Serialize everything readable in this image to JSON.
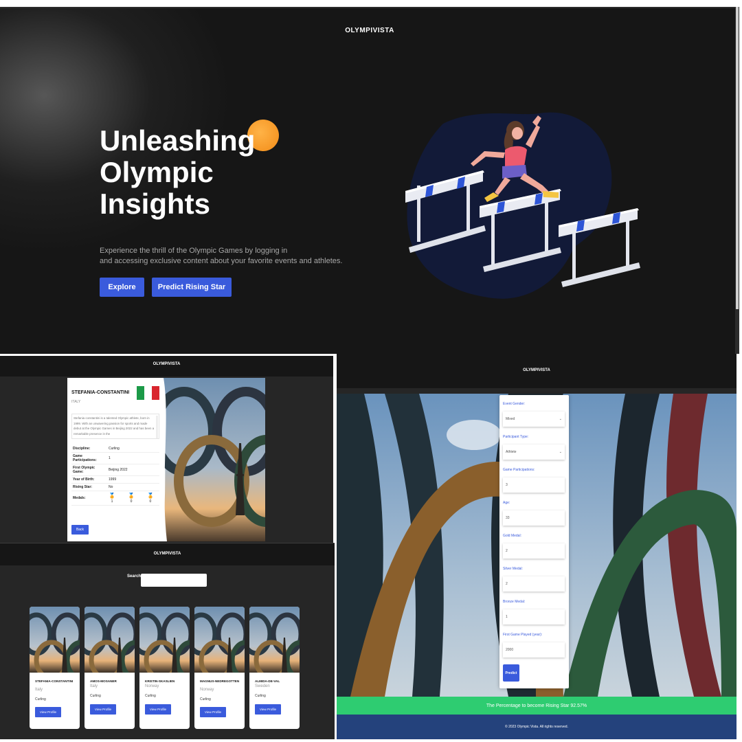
{
  "hero": {
    "brand": "OLYMPIVISTA",
    "headline": [
      "Unleashing",
      "Olympic",
      "Insights"
    ],
    "description_lines": [
      "Experience the thrill of the Olympic Games by logging in",
      "and accessing exclusive content about your favorite events and athletes."
    ],
    "explore_label": "Explore",
    "predict_label": "Predict Rising Star",
    "accent_color": "#3a5bdc",
    "illustration": "athlete-jumping-hurdles"
  },
  "profile": {
    "brand": "OLYMPIVISTA",
    "name": "STEFANIA-CONSTANTINI",
    "country": "ITALY",
    "bio": "Stefania constantini is a talented Olympic athlete, born in 1999. With an unwavering passion for sports and made debut at the Olympic Games in Beijing 2022 and has been a remarkable presence in the",
    "rows": [
      {
        "label": "Discipline:",
        "value": "Curling"
      },
      {
        "label": "Game Participations:",
        "value": "1"
      },
      {
        "label": "First Olympic Game:",
        "value": "Beijing 2022"
      },
      {
        "label": "Year of Birth:",
        "value": "1999"
      },
      {
        "label": "Rising Star:",
        "value": "No"
      }
    ],
    "medals_label": "Medals:",
    "medals": [
      {
        "icon": "gold-medal-icon",
        "count": "1",
        "color": "#e3b021"
      },
      {
        "icon": "silver-medal-icon",
        "count": "0",
        "color": "#a8a8a8"
      },
      {
        "icon": "bronze-medal-icon",
        "count": "0",
        "color": "#c27a2c"
      }
    ],
    "back_label": "Back"
  },
  "search": {
    "brand": "OLYMPIVISTA",
    "label": "Search",
    "input_value": "",
    "cards": [
      {
        "name": "STEFANIA-CONSTANTINI",
        "country": "Italy",
        "discipline": "Curling",
        "button": "View Profile"
      },
      {
        "name": "AMOS-MOSANER",
        "country": "Italy",
        "discipline": "Curling",
        "button": "View Profile"
      },
      {
        "name": "KRISTIN-SKASLIEN",
        "country": "Norway",
        "discipline": "Curling",
        "button": "View Profile"
      },
      {
        "name": "MAGNUS-NEDREGOTTEN",
        "country": "Norway",
        "discipline": "Curling",
        "button": "View Profile"
      },
      {
        "name": "ALMIDA-DE-VAL",
        "country": "Sweden",
        "discipline": "Curling",
        "button": "View Profile"
      }
    ]
  },
  "predict": {
    "brand": "OLYMPIVISTA",
    "fields": [
      {
        "label": "Event Gender:",
        "value": "Mixed",
        "type": "select"
      },
      {
        "label": "Participant Type:",
        "value": "Athlete",
        "type": "select"
      },
      {
        "label": "Game Participations:",
        "value": "3",
        "type": "input"
      },
      {
        "label": "Age:",
        "value": "33",
        "type": "input"
      },
      {
        "label": "Gold Medal:",
        "value": "2",
        "type": "input"
      },
      {
        "label": "Silver Medal:",
        "value": "2",
        "type": "input"
      },
      {
        "label": "Bronze Medal:",
        "value": "1",
        "type": "input"
      },
      {
        "label": "First Game Played (year):",
        "value": "2000",
        "type": "input"
      }
    ],
    "button_label": "Predict",
    "result": "The Percentage to become Rising Star 92.57%",
    "footer": "© 2023 Olympic Vista. All rights reserved.",
    "result_color": "#2ecc71",
    "footer_color": "#24427c"
  }
}
